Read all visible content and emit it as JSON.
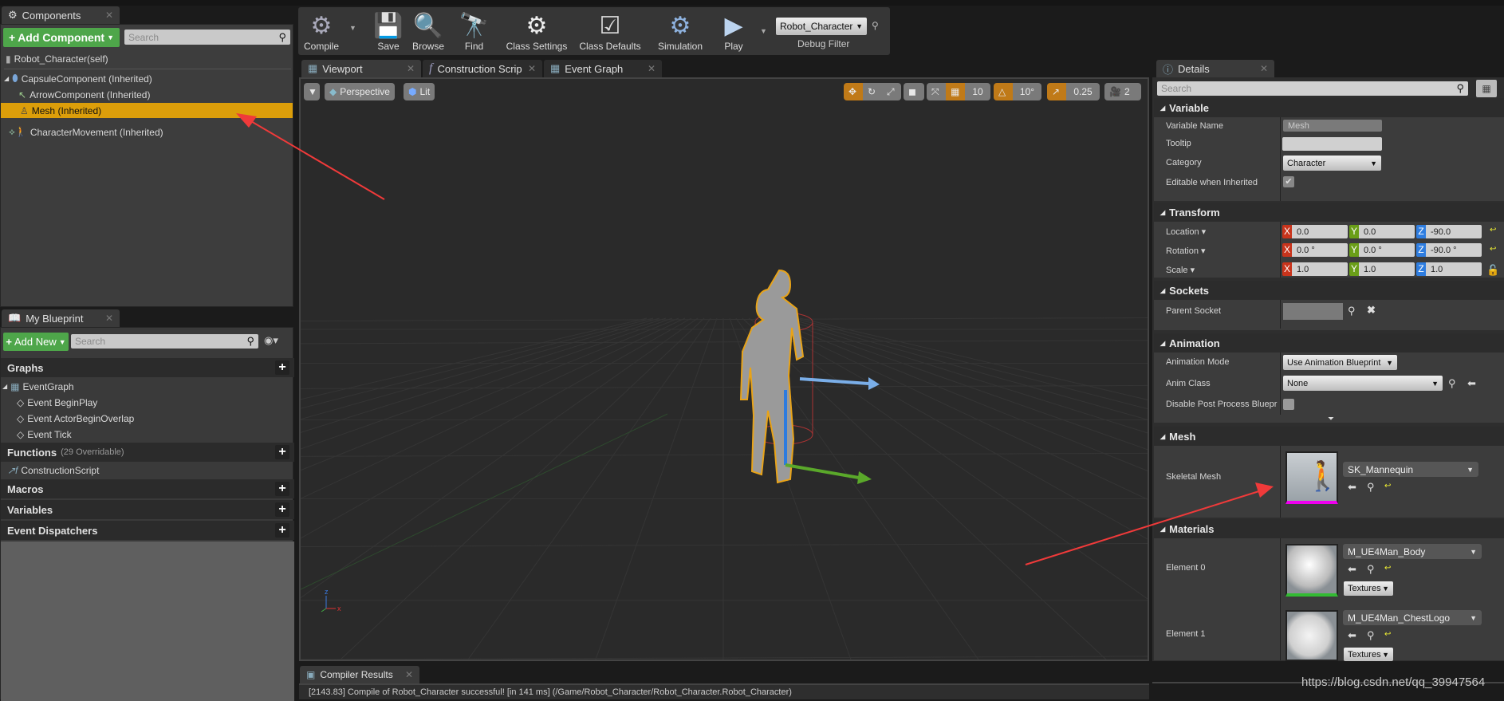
{
  "components": {
    "tab": "Components",
    "add_button": "Add Component",
    "search_placeholder": "Search",
    "self": "Robot_Character(self)",
    "items": [
      {
        "label": "CapsuleComponent (Inherited)",
        "icon": "capsule-icon"
      },
      {
        "label": "ArrowComponent (Inherited)",
        "icon": "arrow-icon"
      },
      {
        "label": "Mesh (Inherited)",
        "icon": "mesh-icon",
        "selected": true
      },
      {
        "label": "CharacterMovement (Inherited)",
        "icon": "movement-icon"
      }
    ]
  },
  "my_blueprint": {
    "tab": "My Blueprint",
    "add_button": "Add New",
    "search_placeholder": "Search",
    "graphs": {
      "label": "Graphs",
      "items": [
        "EventGraph",
        "Event BeginPlay",
        "Event ActorBeginOverlap",
        "Event Tick"
      ]
    },
    "functions": {
      "label": "Functions",
      "count": "(29 Overridable)",
      "items": [
        "ConstructionScript"
      ]
    },
    "macros": "Macros",
    "variables": "Variables",
    "dispatchers": "Event Dispatchers"
  },
  "toolbar": {
    "compile": "Compile",
    "save": "Save",
    "browse": "Browse",
    "find": "Find",
    "class_settings": "Class Settings",
    "class_defaults": "Class Defaults",
    "simulation": "Simulation",
    "play": "Play",
    "debug_value": "Robot_Character",
    "debug_label": "Debug Filter"
  },
  "editor_tabs": [
    "Viewport",
    "Construction Scrip",
    "Event Graph"
  ],
  "viewport": {
    "perspective": "Perspective",
    "lit": "Lit",
    "grid_snap": "10",
    "rot_snap": "10°",
    "scale_snap": "0.25",
    "camera_speed": "2",
    "accent": "#c07a18"
  },
  "compiler": {
    "tab": "Compiler Results",
    "message": "[2143.83] Compile of Robot_Character successful! [in 141 ms] (/Game/Robot_Character/Robot_Character.Robot_Character)"
  },
  "details": {
    "tab": "Details",
    "search_placeholder": "Search",
    "variable": {
      "header": "Variable",
      "name_label": "Variable Name",
      "name_value": "Mesh",
      "tooltip_label": "Tooltip",
      "category_label": "Category",
      "category_value": "Character",
      "editable_label": "Editable when Inherited",
      "editable": true
    },
    "transform": {
      "header": "Transform",
      "location": "Location",
      "rotation": "Rotation",
      "scale": "Scale",
      "loc": [
        "0.0",
        "0.0",
        "-90.0"
      ],
      "rot": [
        "0.0 °",
        "0.0 °",
        "-90.0 °"
      ],
      "scl": [
        "1.0",
        "1.0",
        "1.0"
      ],
      "axes": [
        "X",
        "Y",
        "Z"
      ]
    },
    "sockets": {
      "header": "Sockets",
      "parent_label": "Parent Socket"
    },
    "animation": {
      "header": "Animation",
      "mode_label": "Animation Mode",
      "mode_value": "Use Animation Blueprint",
      "class_label": "Anim Class",
      "class_value": "None",
      "disable_label": "Disable Post Process Bluepr"
    },
    "mesh": {
      "header": "Mesh",
      "label": "Skeletal Mesh",
      "value": "SK_Mannequin"
    },
    "materials": {
      "header": "Materials",
      "elements": [
        {
          "label": "Element 0",
          "value": "M_UE4Man_Body",
          "textures": "Textures"
        },
        {
          "label": "Element 1",
          "value": "M_UE4Man_ChestLogo",
          "textures": "Textures"
        }
      ]
    }
  },
  "watermark": "https://blog.csdn.net/qq_39947564"
}
